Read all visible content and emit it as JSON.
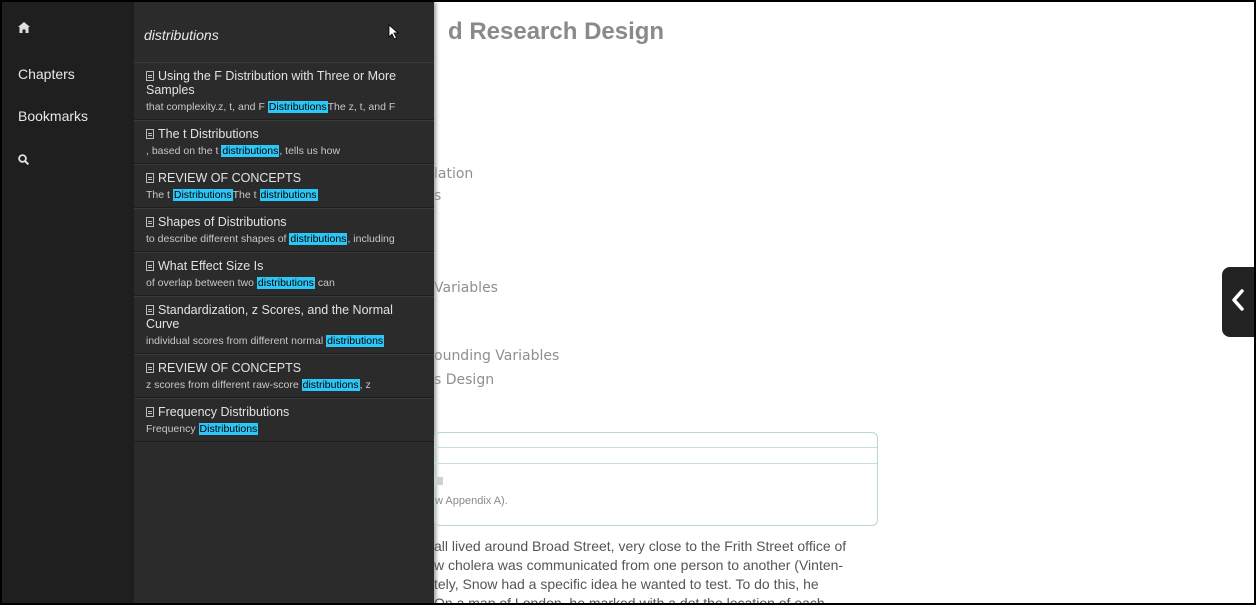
{
  "sidebar": {
    "home_icon": "home-icon",
    "items": [
      {
        "label": "Chapters"
      },
      {
        "label": "Bookmarks"
      }
    ],
    "search_icon": "search-icon"
  },
  "search": {
    "value": "distributions",
    "results": [
      {
        "title": "Using the F Distribution with Three or More Samples",
        "pre": "that complexity.z, t, and F ",
        "hit": "Distributions",
        "post": "The z, t, and F"
      },
      {
        "title": "The t Distributions",
        "pre": ", based on the t ",
        "hit": "distributions",
        "post": ", tells us how"
      },
      {
        "title": "REVIEW OF CONCEPTS",
        "pre": "The t ",
        "hit": "Distributions",
        "mid": "The t ",
        "hit2": "distributions",
        "post": ""
      },
      {
        "title": "Shapes of Distributions",
        "pre": "to describe different shapes of ",
        "hit": "distributions",
        "post": ", including"
      },
      {
        "title": "What Effect Size Is",
        "pre": "of overlap between two ",
        "hit": "distributions",
        "post": " can"
      },
      {
        "title": "Standardization, z Scores, and the Normal Curve",
        "pre": "individual scores from different normal ",
        "hit": "distributions",
        "post": ""
      },
      {
        "title": "REVIEW OF CONCEPTS",
        "pre": "z scores from different raw-score ",
        "hit": "distributions",
        "post": ", z"
      },
      {
        "title": "Frequency Distributions",
        "pre": "Frequency ",
        "hit": "Distributions",
        "post": ""
      }
    ]
  },
  "content": {
    "title": "d Research Design",
    "toc": [
      "lation",
      "s",
      "Variables",
      "ounding Variables",
      "s Design"
    ],
    "box_text": "w Appendix A).",
    "paragraph": [
      "all lived around Broad Street, very close to the Frith Street office of",
      "w cholera was communicated from one person to another (Vinten-",
      "tely, Snow had a specific idea he wanted to test. To do this, he",
      "On a map of London, he marked with a dot the location of each"
    ]
  },
  "toggle_icon": "chevron-left-icon"
}
